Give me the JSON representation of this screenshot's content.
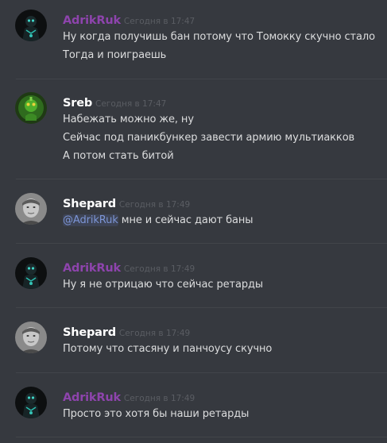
{
  "colors": {
    "background": "#36393f",
    "divider": "#42454a",
    "text": "#dcddde",
    "timestamp": "#5a5d63",
    "mention": "#7c95d6"
  },
  "messages": [
    {
      "author": "AdrikRuk",
      "author_color": "#8e44ad",
      "avatar_icon": "dark-armored-figure-avatar",
      "timestamp": "Сегодня в 17:47",
      "lines": [
        "Ну когда получишь бан потому что Томокку скучно стало",
        "Тогда и поиграешь"
      ]
    },
    {
      "author": "Sreb",
      "author_color": "#ffffff",
      "avatar_icon": "green-creature-avatar",
      "timestamp": "Сегодня в 17:47",
      "lines": [
        "Набежать можно же, ну",
        "Сейчас под паникбункер завести армию мультиакков",
        "А потом стать битой"
      ]
    },
    {
      "author": "Shepard",
      "author_color": "#ffffff",
      "avatar_icon": "grayscale-face-avatar",
      "timestamp": "Сегодня в 17:49",
      "mention": "@AdrikRuk",
      "lines": [
        " мне и сейчас дают баны"
      ]
    },
    {
      "author": "AdrikRuk",
      "author_color": "#8e44ad",
      "avatar_icon": "dark-armored-figure-avatar",
      "timestamp": "Сегодня в 17:49",
      "lines": [
        "Ну я не отрицаю что сейчас ретарды"
      ]
    },
    {
      "author": "Shepard",
      "author_color": "#ffffff",
      "avatar_icon": "grayscale-face-avatar",
      "timestamp": "Сегодня в 17:49",
      "lines": [
        "Потому что стасяну и панчоусу скучно"
      ]
    },
    {
      "author": "AdrikRuk",
      "author_color": "#8e44ad",
      "avatar_icon": "dark-armored-figure-avatar",
      "timestamp": "Сегодня в 17:49",
      "lines": [
        "Просто это хотя бы наши ретарды"
      ]
    }
  ]
}
